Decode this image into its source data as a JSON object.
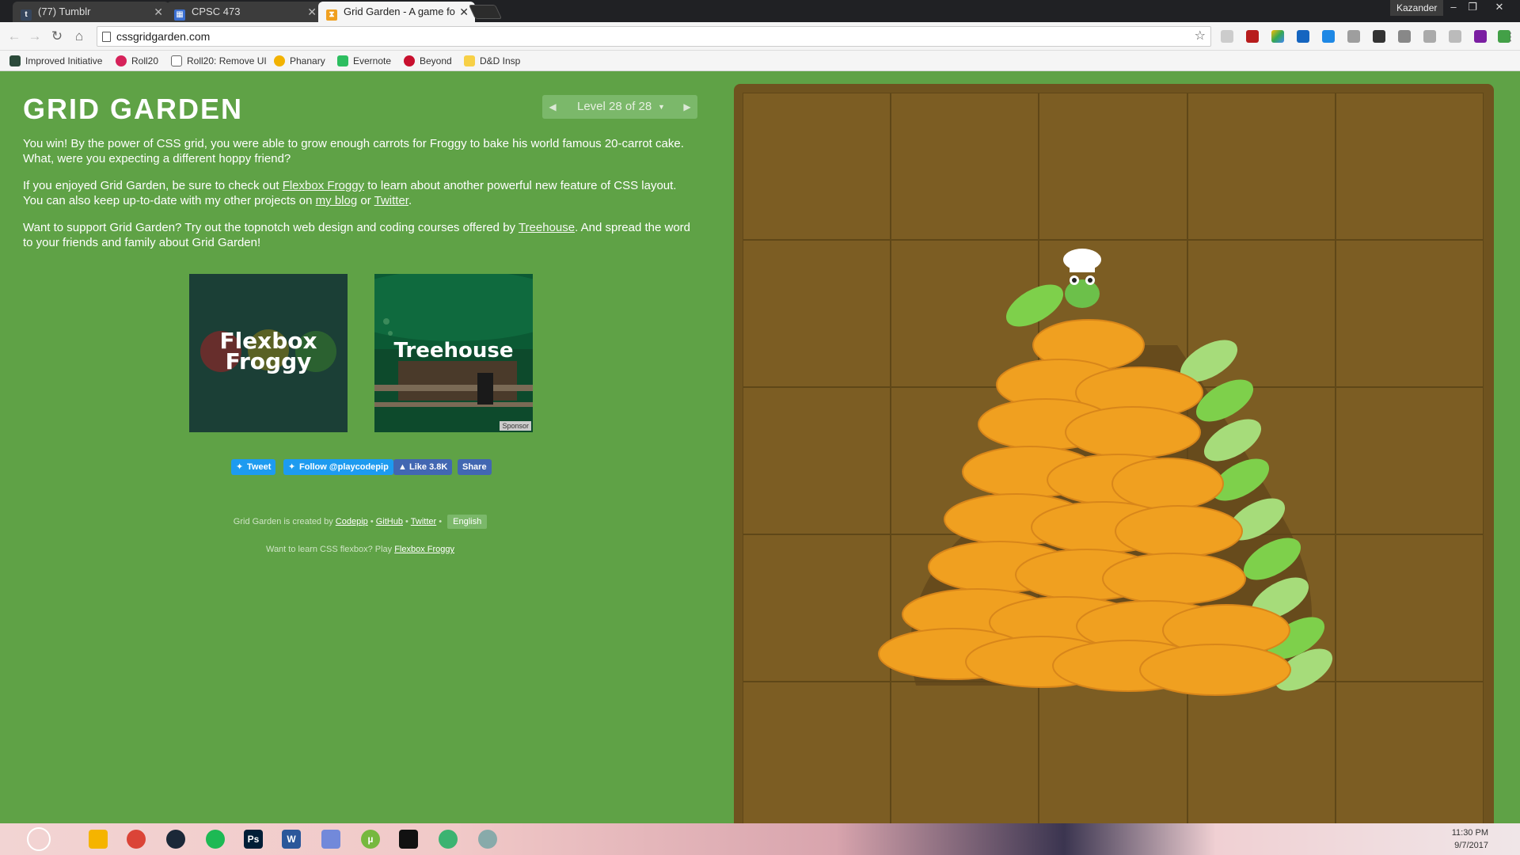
{
  "browser": {
    "tabs": [
      {
        "label": "(77) Tumblr",
        "active": false
      },
      {
        "label": "CPSC 473",
        "active": false
      },
      {
        "label": "Grid Garden - A game fo",
        "active": true
      }
    ],
    "profile_name": "Kazander",
    "window_controls": {
      "minimize": "–",
      "restore": "❐",
      "close": "✕"
    },
    "url": "cssgridgarden.com",
    "bookmarks": [
      {
        "label": "Improved Initiative",
        "color": "#2b4a3a"
      },
      {
        "label": "Roll20",
        "color": "#d6225a"
      },
      {
        "label": "Roll20: Remove UI",
        "color": "#ffffff"
      },
      {
        "label": "Phanary",
        "color": "#f2b200"
      },
      {
        "label": "Evernote",
        "color": "#2dbe60"
      },
      {
        "label": "Beyond",
        "color": "#c8102e"
      },
      {
        "label": "D&D Insp",
        "color": "#f7d046"
      }
    ]
  },
  "page": {
    "title": "GRID GARDEN",
    "level": {
      "text": "Level 28 of 28",
      "prev": "◀",
      "next": "▶",
      "caret": "▼"
    },
    "paragraphs": {
      "p1": "You win! By the power of CSS grid, you were able to grow enough carrots for Froggy to bake his world famous 20-carrot cake. What, were you expecting a different hoppy friend?",
      "p2_pre": "If you enjoyed Grid Garden, be sure to check out ",
      "p2_link1": "Flexbox Froggy",
      "p2_mid": " to learn about another powerful new feature of CSS layout. You can also keep up-to-date with my other projects on ",
      "p2_link2": "my blog",
      "p2_or": " or ",
      "p2_link3": "Twitter",
      "p2_end": ".",
      "p3_pre": "Want to support Grid Garden? Try out the topnotch web design and coding courses offered by ",
      "p3_link": "Treehouse",
      "p3_end": ". And spread the word to your friends and family about Grid Garden!"
    },
    "promos": {
      "froggy_line1": "Flexbox",
      "froggy_line2": "Froggy",
      "treehouse": "Treehouse",
      "sponsor": "Sponsor"
    },
    "social": {
      "tweet": "Tweet",
      "follow": "Follow @playcodepip",
      "like": "Like 3.8K",
      "share": "Share"
    },
    "footer": {
      "created_by": "Grid Garden is created by ",
      "codepip": "Codepip",
      "sep": " • ",
      "github": "GitHub",
      "twitter": "Twitter",
      "language": "English",
      "flexbox_pre": "Want to learn CSS flexbox? Play ",
      "flexbox_link": "Flexbox Froggy"
    }
  },
  "colors": {
    "page_bg": "#5fa246",
    "soil": "#7c5d23",
    "carrot": "#f0a020",
    "carrot_top": "#7ed04b"
  },
  "taskbar": {
    "time": "11:30 PM",
    "date": "9/7/2017"
  }
}
